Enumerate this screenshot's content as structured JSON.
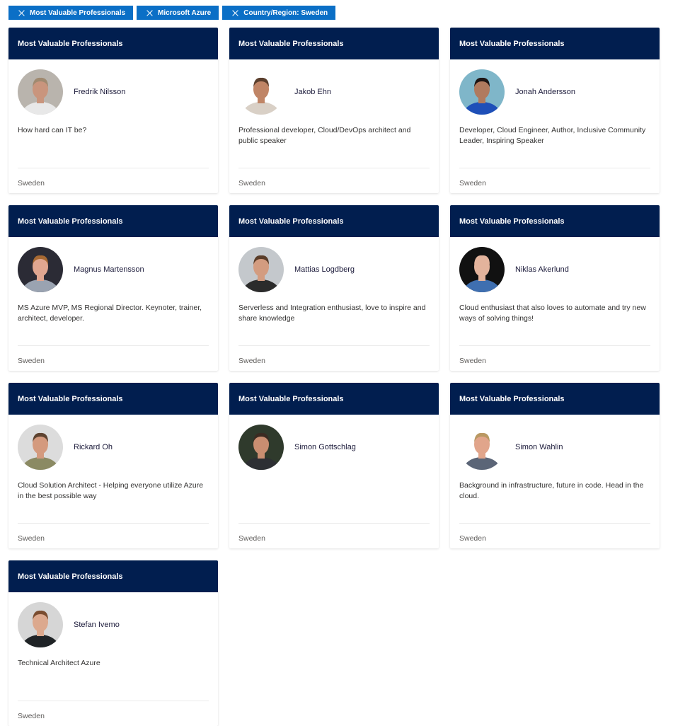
{
  "filters": [
    {
      "label": "Most Valuable Professionals",
      "icon": "close-icon"
    },
    {
      "label": "Microsoft Azure",
      "icon": "close-icon"
    },
    {
      "label": "Country/Region: Sweden",
      "icon": "close-icon"
    }
  ],
  "colors": {
    "chip_bg": "#0b6fc6",
    "card_header_bg": "#011e4f",
    "name_text": "#1b1a3a",
    "country_text": "#605e5c"
  },
  "cards": [
    {
      "category": "Most Valuable Professionals",
      "name": "Fredrik Nilsson",
      "bio": "How hard can IT be?",
      "country": "Sweden",
      "avatar": {
        "bg": "#b9b4ad",
        "skin": "#c9957d",
        "hair": "#a08a70",
        "shirt": "#e8e8e8"
      }
    },
    {
      "category": "Most Valuable Professionals",
      "name": "Jakob Ehn",
      "bio": "Professional developer, Cloud/DevOps architect and public speaker",
      "country": "Sweden",
      "avatar": {
        "bg": "#ffffff",
        "skin": "#c08566",
        "hair": "#5b3f2d",
        "shirt": "#d9d0c6"
      }
    },
    {
      "category": "Most Valuable Professionals",
      "name": "Jonah Andersson",
      "bio": "Developer, Cloud Engineer, Author, Inclusive Community Leader, Inspiring Speaker",
      "country": "Sweden",
      "avatar": {
        "bg": "#7fb6c9",
        "skin": "#b07a5e",
        "hair": "#1d1413",
        "shirt": "#1e4fb8"
      }
    },
    {
      "category": "Most Valuable Professionals",
      "name": "Magnus Martensson",
      "bio": "MS Azure MVP, MS Regional Director. Keynoter, trainer, architect, developer.",
      "country": "Sweden",
      "avatar": {
        "bg": "#2b2b35",
        "skin": "#e0a690",
        "hair": "#a86a33",
        "shirt": "#9aa3b1"
      }
    },
    {
      "category": "Most Valuable Professionals",
      "name": "Mattias Logdberg",
      "bio": "Serverless and Integration enthusiast, love to inspire and share knowledge",
      "country": "Sweden",
      "avatar": {
        "bg": "#c4c8cc",
        "skin": "#d39c80",
        "hair": "#5a3d29",
        "shirt": "#2b2b2b"
      }
    },
    {
      "category": "Most Valuable Professionals",
      "name": "Niklas Akerlund",
      "bio": "Cloud enthusiast that also loves to automate and try new ways of solving things!",
      "country": "Sweden",
      "avatar": {
        "bg": "#111111",
        "skin": "#e3b39c",
        "hair": "#e3b39c",
        "shirt": "#3f6fb0"
      }
    },
    {
      "category": "Most Valuable Professionals",
      "name": "Rickard Oh",
      "bio": "Cloud Solution Architect - Helping everyone utilize Azure in the best possible way",
      "country": "Sweden",
      "avatar": {
        "bg": "#dcdcdc",
        "skin": "#d49a7e",
        "hair": "#5e4330",
        "shirt": "#8b8a63"
      }
    },
    {
      "category": "Most Valuable Professionals",
      "name": "Simon Gottschlag",
      "bio": "",
      "country": "Sweden",
      "avatar": {
        "bg": "#2f3a2c",
        "skin": "#c98e71",
        "hair": "#3b2b22",
        "shirt": "#2d2f33"
      }
    },
    {
      "category": "Most Valuable Professionals",
      "name": "Simon Wahlin",
      "bio": "Background in infrastructure, future in code. Head in the cloud.",
      "country": "Sweden",
      "avatar": {
        "bg": "#ffffff",
        "skin": "#e1a58b",
        "hair": "#b99862",
        "shirt": "#5b6577"
      }
    },
    {
      "category": "Most Valuable Professionals",
      "name": "Stefan Ivemo",
      "bio": "Technical Architect Azure",
      "country": "Sweden",
      "avatar": {
        "bg": "#d6d6d6",
        "skin": "#dca98e",
        "hair": "#7a4d30",
        "shirt": "#1f2326"
      }
    }
  ]
}
